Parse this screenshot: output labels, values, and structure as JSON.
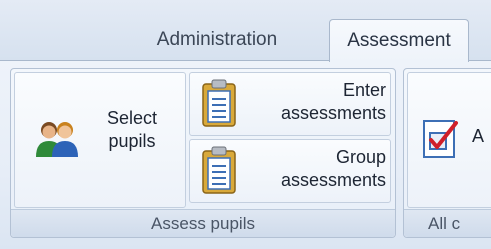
{
  "tabs": [
    {
      "label": "Administration",
      "active": false
    },
    {
      "label": "Assessment",
      "active": true
    }
  ],
  "groups": {
    "assess_pupils": {
      "caption": "Assess pupils",
      "select_pupils": {
        "label_line1": "Select",
        "label_line2": "pupils",
        "icon": "users-icon"
      },
      "enter_assessments": {
        "label_line1": "Enter",
        "label_line2": "assessments",
        "icon": "clipboard-icon"
      },
      "group_assessments": {
        "label_line1": "Group",
        "label_line2": "assessments",
        "icon": "clipboard-icon"
      }
    },
    "all": {
      "caption": "All c",
      "button": {
        "label": "A",
        "icon": "checklist-icon"
      }
    }
  },
  "colors": {
    "ribbon_bg": "#e6edf7",
    "border": "#a9b8cc",
    "check_red": "#d0202a",
    "clipboard_gold": "#d9a93a"
  }
}
